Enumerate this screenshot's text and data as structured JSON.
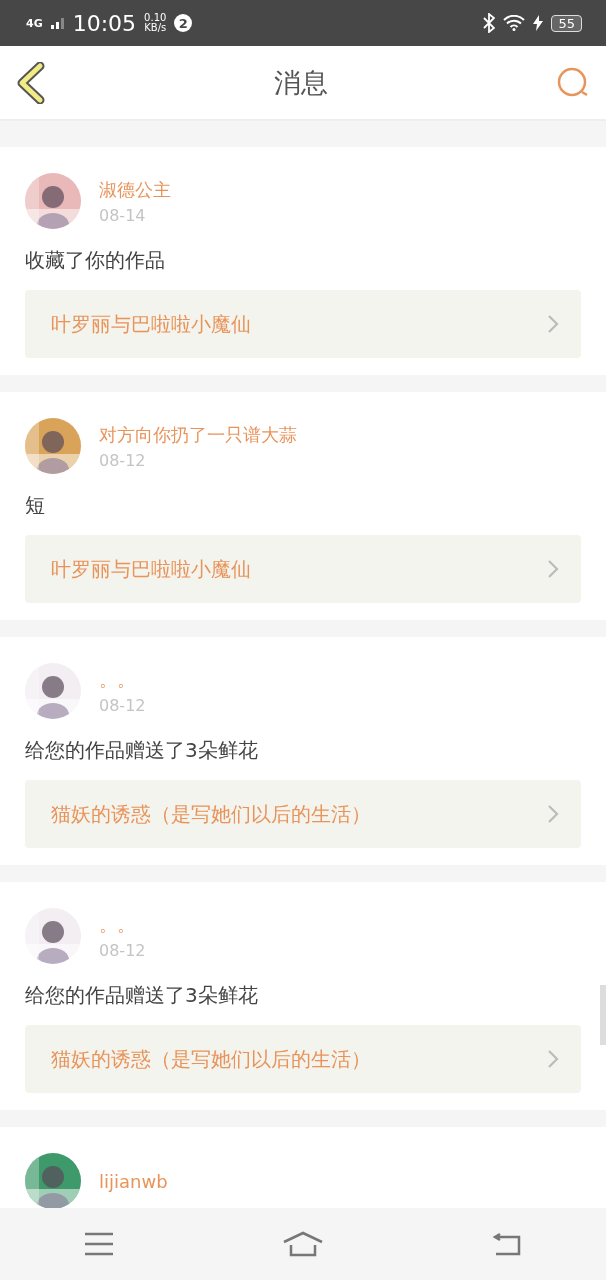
{
  "status_bar": {
    "network": "4G",
    "time": "10:05",
    "speed": "0.10",
    "speed_unit": "KB/s",
    "notification_count": "2",
    "battery": "55"
  },
  "header": {
    "title": "消息"
  },
  "messages": [
    {
      "name": "淑德公主",
      "date": "08-14",
      "text": "收藏了你的作品",
      "work": "叶罗丽与巴啦啦小魔仙"
    },
    {
      "name": "对方向你扔了一只谱大蒜",
      "date": "08-12",
      "text": "短",
      "work": "叶罗丽与巴啦啦小魔仙"
    },
    {
      "name": "。。",
      "date": "08-12",
      "text": "给您的作品赠送了3朵鲜花",
      "work": "猫妖的诱惑（是写她们以后的生活）"
    },
    {
      "name": "。。",
      "date": "08-12",
      "text": "给您的作品赠送了3朵鲜花",
      "work": "猫妖的诱惑（是写她们以后的生活）"
    },
    {
      "name": "lijianwb"
    }
  ]
}
